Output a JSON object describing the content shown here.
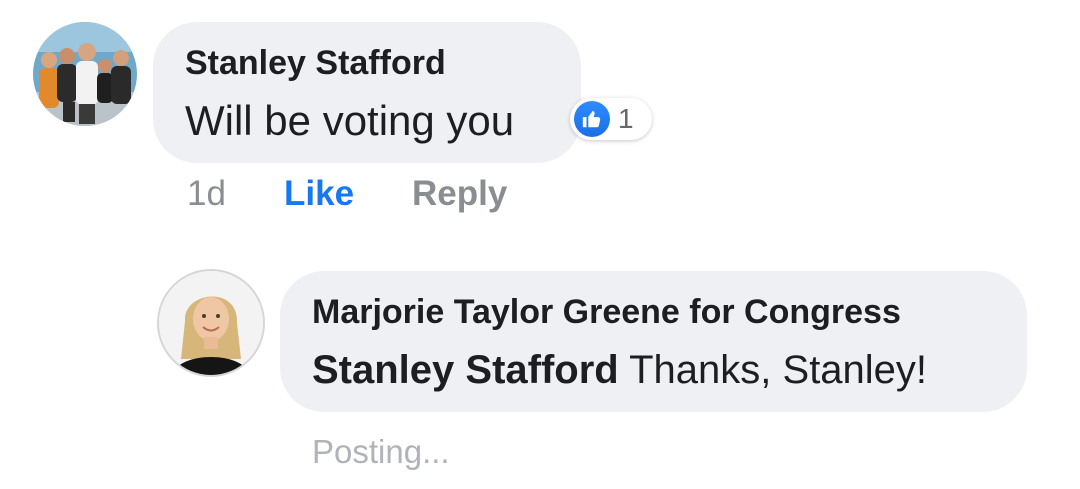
{
  "comment": {
    "author": "Stanley Stafford",
    "text": "Will be voting you",
    "reaction_count": "1",
    "time": "1d",
    "like_label": "Like",
    "reply_label": "Reply",
    "like_color": "#1877f2"
  },
  "reply": {
    "author": "Marjorie Taylor Greene for Congress",
    "mention": "Stanley Stafford",
    "text": " Thanks, Stanley!",
    "status": "Posting..."
  },
  "icons": {
    "reaction": "thumbs-up-icon"
  }
}
